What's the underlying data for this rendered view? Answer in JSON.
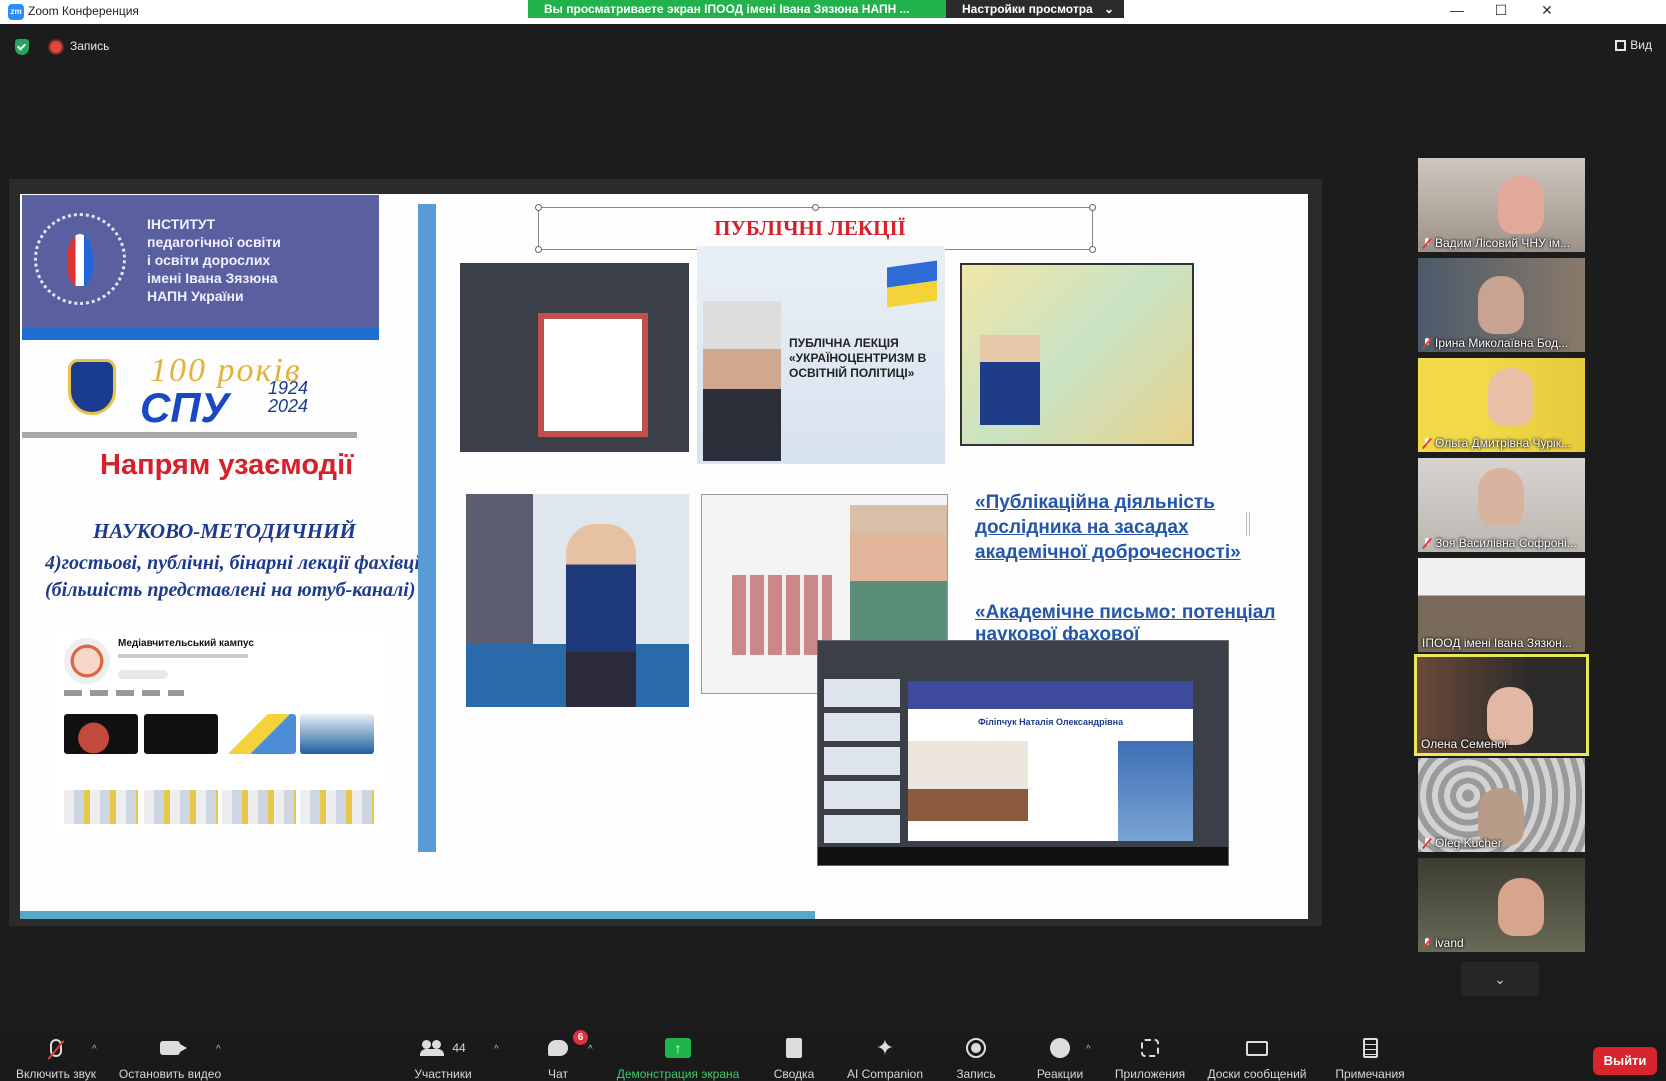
{
  "window": {
    "title": "Zoom Конференция",
    "logo_text": "zm",
    "share_banner": "Вы просматриваете экран ІПООД імені Івана Зязюна НАПН ...",
    "view_options": "Настройки просмотра"
  },
  "topbar": {
    "record_label": "Запись",
    "view_label": "Вид"
  },
  "slide": {
    "institute": "ІНСТИТУТ\nпедагогічної освіти\nі освіти дорослих\nімені Івана Зязюна\nНАПН України",
    "anniversary": "100 років",
    "university": "СПУ",
    "years": "1924\n2024",
    "direction_title": "Напрям узаємодії",
    "method_title": "НАУКОВО-МЕТОДИЧНИЙ",
    "method_text": "4)гостьові, публічні, бінарні лекції фахівців (більшість представлені на ютуб-каналі)",
    "lectures_title": "ПУБЛІЧНІ ЛЕКЦІЇ",
    "youtube_channel": "Медіавчительський кампус",
    "poster_text": "ПУБЛІЧНА ЛЕКЦІЯ «УКРАЇНОЦЕНТРИЗМ В ОСВІТНІЙ ПОЛІТИЦІ»",
    "link1": "«Публікаційна діяльність дослідника на засадах академічної доброчесності»",
    "link2": "«Академічне письмо: потенціал наукової фахової"
  },
  "participants": [
    {
      "name": "Вадим Лісовий ЧНУ ім...",
      "muted": true
    },
    {
      "name": "Ірина Миколаївна Бод...",
      "muted": true
    },
    {
      "name": "Ольга Дмитрівна Чурік...",
      "muted": true
    },
    {
      "name": "Зоя Василівна Софроні...",
      "muted": true
    },
    {
      "name": "ІПООД імені Івана Зязюн...",
      "muted": false
    },
    {
      "name": "Олена Семеног",
      "muted": false,
      "active": true
    },
    {
      "name": "Oleg Kucher",
      "muted": true
    },
    {
      "name": "ivand",
      "muted": true
    }
  ],
  "toolbar": {
    "mic": "Включить звук",
    "video": "Остановить видео",
    "participants": "Участники",
    "participants_count": "44",
    "chat": "Чат",
    "chat_badge": "6",
    "share": "Демонстрация экрана",
    "summary": "Сводка",
    "ai": "AI Companion",
    "record": "Запись",
    "reactions": "Реакции",
    "apps": "Приложения",
    "boards": "Доски сообщений",
    "notes": "Примечания",
    "leave": "Выйти"
  },
  "colors": {
    "share_banner": "#22b24c",
    "active_speaker": "#e8e95a",
    "leave": "#d8242c",
    "slide_red": "#d6202b",
    "slide_blue": "#1d3a8f"
  }
}
